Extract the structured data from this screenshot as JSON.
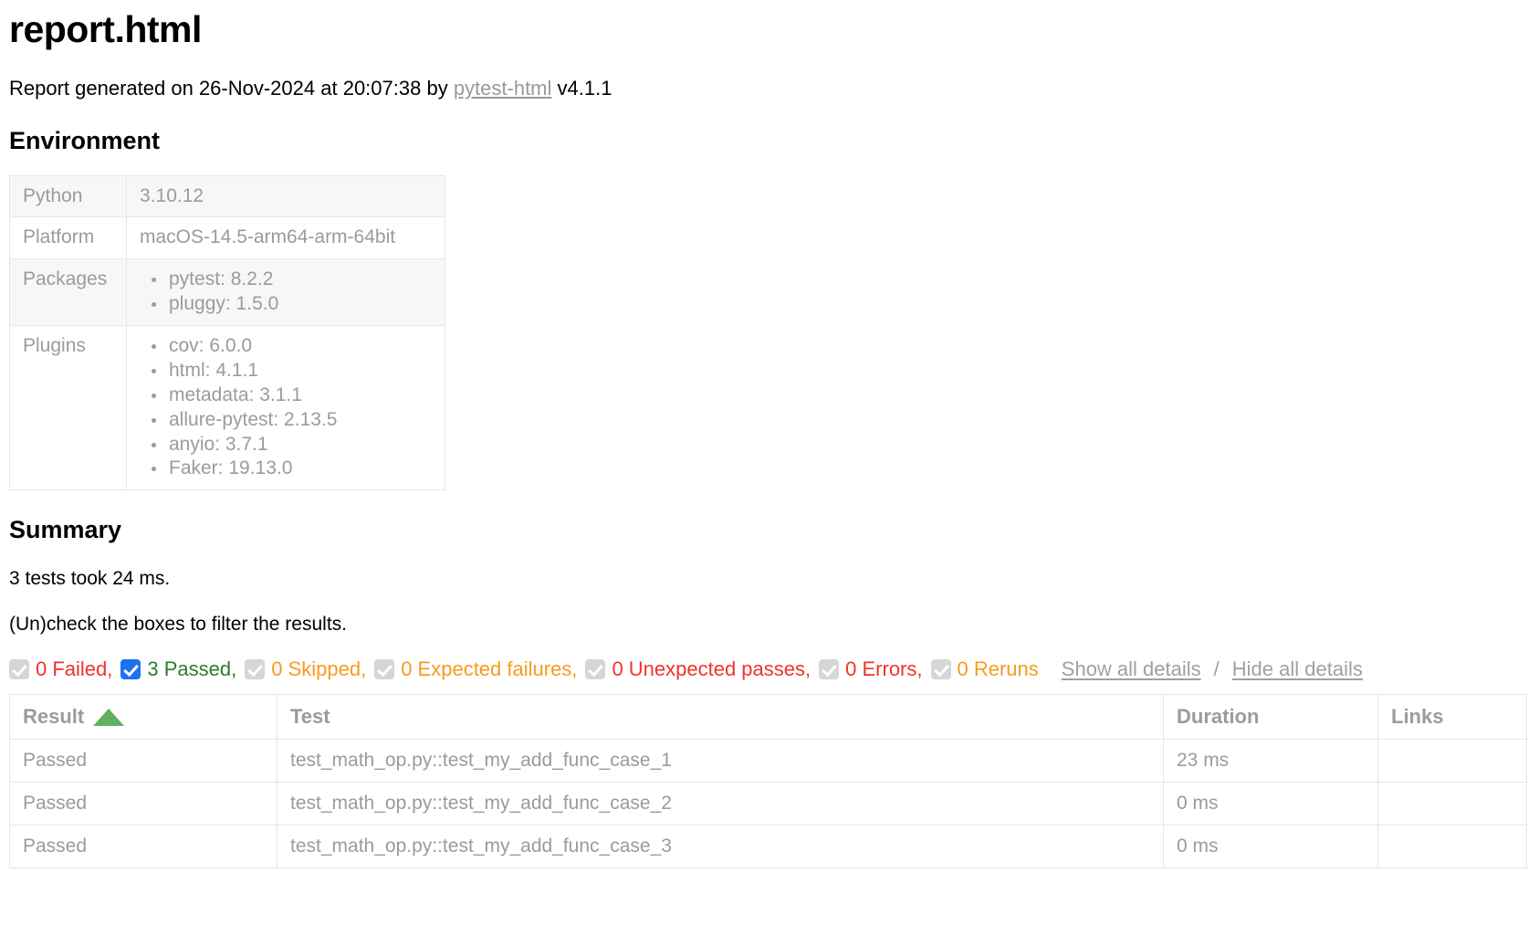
{
  "page": {
    "title": "report.html",
    "generated_prefix": "Report generated on ",
    "generated_date": "26-Nov-2024",
    "generated_mid": " at ",
    "generated_time": "20:07:38",
    "generated_by": " by ",
    "generator_link": "pytest-html",
    "generator_version": " v4.1.1"
  },
  "environment": {
    "heading": "Environment",
    "rows": [
      {
        "key": "Python",
        "value": "3.10.12",
        "items": null
      },
      {
        "key": "Platform",
        "value": "macOS-14.5-arm64-arm-64bit",
        "items": null
      },
      {
        "key": "Packages",
        "value": null,
        "items": [
          "pytest: 8.2.2",
          "pluggy: 1.5.0"
        ]
      },
      {
        "key": "Plugins",
        "value": null,
        "items": [
          "cov: 6.0.0",
          "html: 4.1.1",
          "metadata: 3.1.1",
          "allure-pytest: 2.13.5",
          "anyio: 3.7.1",
          "Faker: 19.13.0"
        ]
      }
    ]
  },
  "summary": {
    "heading": "Summary",
    "tests_line": "3 tests took 24 ms.",
    "filter_hint": "(Un)check the boxes to filter the results.",
    "filters": [
      {
        "label": "0 Failed,",
        "color": "#f0332b",
        "checked": true,
        "active": false
      },
      {
        "label": "3 Passed,",
        "color": "#2a7d2a",
        "checked": true,
        "active": true
      },
      {
        "label": "0 Skipped,",
        "color": "#f79a1e",
        "checked": true,
        "active": false
      },
      {
        "label": "0 Expected failures,",
        "color": "#f79a1e",
        "checked": true,
        "active": false
      },
      {
        "label": "0 Unexpected passes,",
        "color": "#f0332b",
        "checked": true,
        "active": false
      },
      {
        "label": "0 Errors,",
        "color": "#f0332b",
        "checked": true,
        "active": false
      },
      {
        "label": "0 Reruns",
        "color": "#f79a1e",
        "checked": true,
        "active": false
      }
    ],
    "show_all_details": "Show all details",
    "separator": "/",
    "hide_all_details": "Hide all details"
  },
  "results_table": {
    "columns": [
      "Result",
      "Test",
      "Duration",
      "Links"
    ],
    "sort_column": "Result",
    "sort_direction": "ascending",
    "sort_indicator_color": "#61b061",
    "rows": [
      {
        "result": "Passed",
        "test": "test_math_op.py::test_my_add_func_case_1",
        "duration": "23 ms",
        "links": ""
      },
      {
        "result": "Passed",
        "test": "test_math_op.py::test_my_add_func_case_2",
        "duration": "0 ms",
        "links": ""
      },
      {
        "result": "Passed",
        "test": "test_math_op.py::test_my_add_func_case_3",
        "duration": "0 ms",
        "links": ""
      }
    ]
  },
  "colors": {
    "failed": "#f0332b",
    "passed": "#2a7d2a",
    "skipped": "#f79a1e",
    "checkbox_active": "#1f71f0",
    "checkbox_disabled": "#d6d6d6",
    "muted_text": "#9b9b9b",
    "border": "#e6e6e6"
  }
}
